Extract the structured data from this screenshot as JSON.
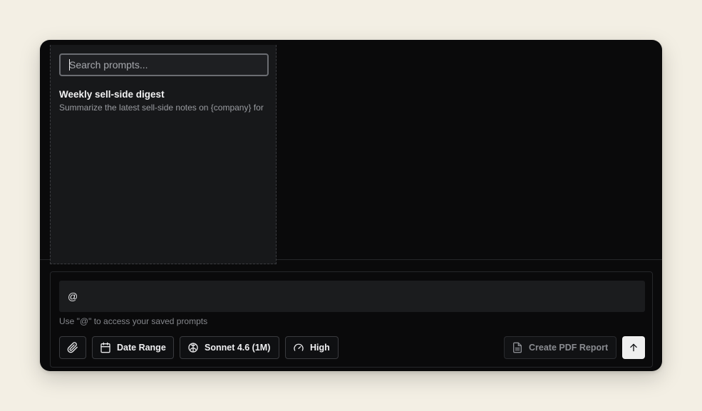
{
  "prompt_picker": {
    "search": {
      "placeholder": "Search prompts...",
      "value": ""
    },
    "items": [
      {
        "title": "Weekly sell-side digest",
        "description": "Summarize the latest sell-side notes on {company} for"
      }
    ]
  },
  "composer": {
    "input_value": "@",
    "hint": "Use \"@\" to access your saved prompts",
    "toolbar": {
      "attach_icon": "paperclip-icon",
      "date_range": {
        "icon": "calendar-icon",
        "label": "Date Range"
      },
      "model": {
        "icon": "brain-icon",
        "label": "Sonnet 4.6 (1M)"
      },
      "effort": {
        "icon": "gauge-icon",
        "label": "High"
      },
      "pdf_report": {
        "icon": "document-icon",
        "label": "Create PDF Report"
      },
      "send_icon": "arrow-up-icon"
    }
  },
  "colors": {
    "page_background": "#f3efe4",
    "window_background": "#0a0a0b",
    "popover_background": "#17181a",
    "send_button": "#efefef"
  }
}
